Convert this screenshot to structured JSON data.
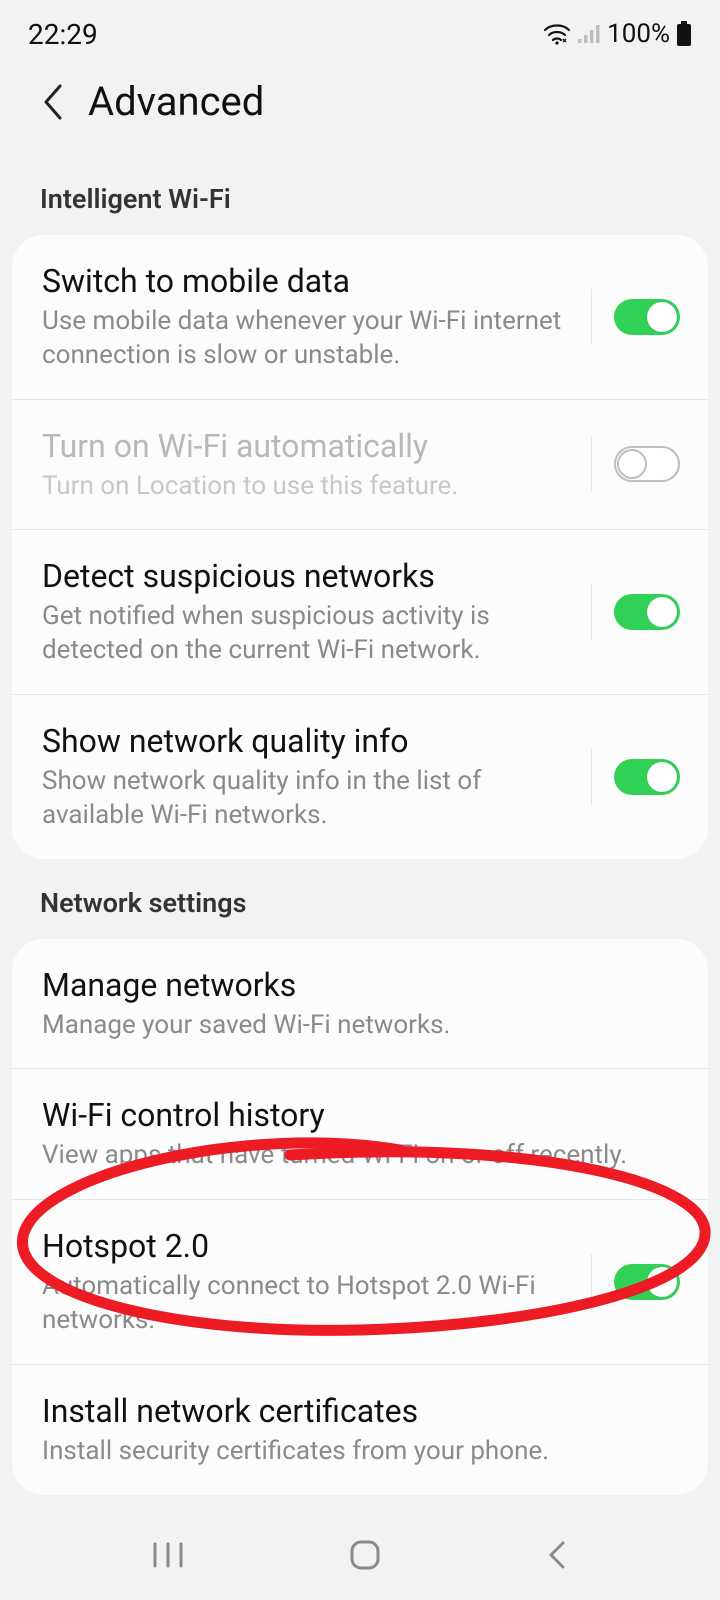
{
  "status": {
    "time": "22:29",
    "battery_text": "100%"
  },
  "header": {
    "title": "Advanced"
  },
  "section1": {
    "label": "Intelligent Wi-Fi",
    "items": [
      {
        "title": "Switch to mobile data",
        "sub": "Use mobile data whenever your Wi-Fi internet connection is slow or unstable.",
        "toggle": "on"
      },
      {
        "title": "Turn on Wi-Fi automatically",
        "sub": "Turn on Location to use this feature.",
        "toggle": "off-disabled"
      },
      {
        "title": "Detect suspicious networks",
        "sub": "Get notified when suspicious activity is detected on the current Wi-Fi network.",
        "toggle": "on"
      },
      {
        "title": "Show network quality info",
        "sub": "Show network quality info in the list of available Wi-Fi networks.",
        "toggle": "on"
      }
    ]
  },
  "section2": {
    "label": "Network settings",
    "items": [
      {
        "title": "Manage networks",
        "sub": "Manage your saved Wi-Fi networks."
      },
      {
        "title": "Wi-Fi control history",
        "sub": "View apps that have turned Wi-Fi on or off recently."
      },
      {
        "title": "Hotspot 2.0",
        "sub": "Automatically connect to Hotspot 2.0 Wi-Fi networks.",
        "toggle": "on"
      },
      {
        "title": "Install network certificates",
        "sub": "Install security certificates from your phone."
      }
    ]
  }
}
